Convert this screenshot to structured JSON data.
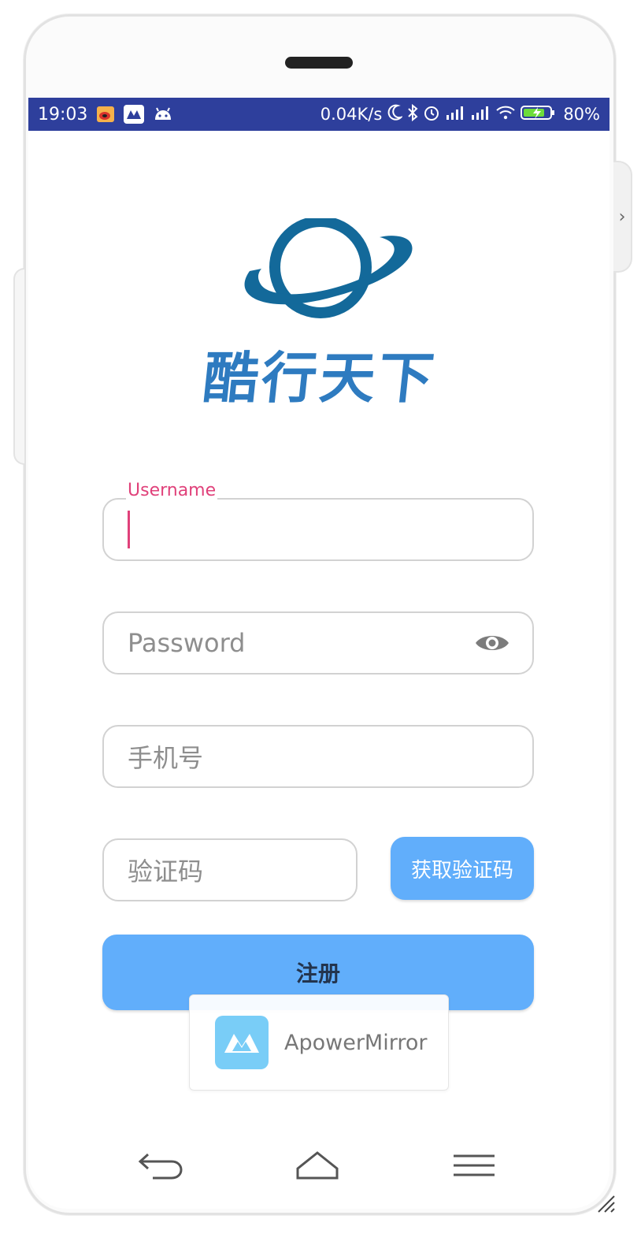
{
  "status_bar": {
    "time": "19:03",
    "network_speed": "0.04K/s",
    "battery_percent": "80%",
    "left_icons": [
      "weibo-icon",
      "apowermirror-icon",
      "android-icon"
    ],
    "right_icons": [
      "moon-icon",
      "bluetooth-icon",
      "alarm-icon",
      "signal-icon",
      "signal-icon",
      "wifi-icon",
      "battery-charging-icon"
    ],
    "background_color": "#2e3f9c"
  },
  "brand": {
    "name": "酷行天下",
    "logo_icon": "planet-orbit-logo",
    "color": "#2e7bc0"
  },
  "form": {
    "username": {
      "label": "Username",
      "value": "",
      "focused": true
    },
    "password": {
      "placeholder": "Password",
      "toggle_icon": "eye-icon"
    },
    "phone": {
      "placeholder": "手机号"
    },
    "code": {
      "placeholder": "验证码"
    },
    "get_code_button": "获取验证码",
    "register_button": "注册",
    "accent_color": "#e0417a",
    "button_color": "#61aefb"
  },
  "toast": {
    "app_name": "ApowerMirror",
    "icon": "apowermirror-icon"
  },
  "nav_bar": {
    "buttons": [
      "back-icon",
      "home-icon",
      "menu-icon"
    ]
  }
}
